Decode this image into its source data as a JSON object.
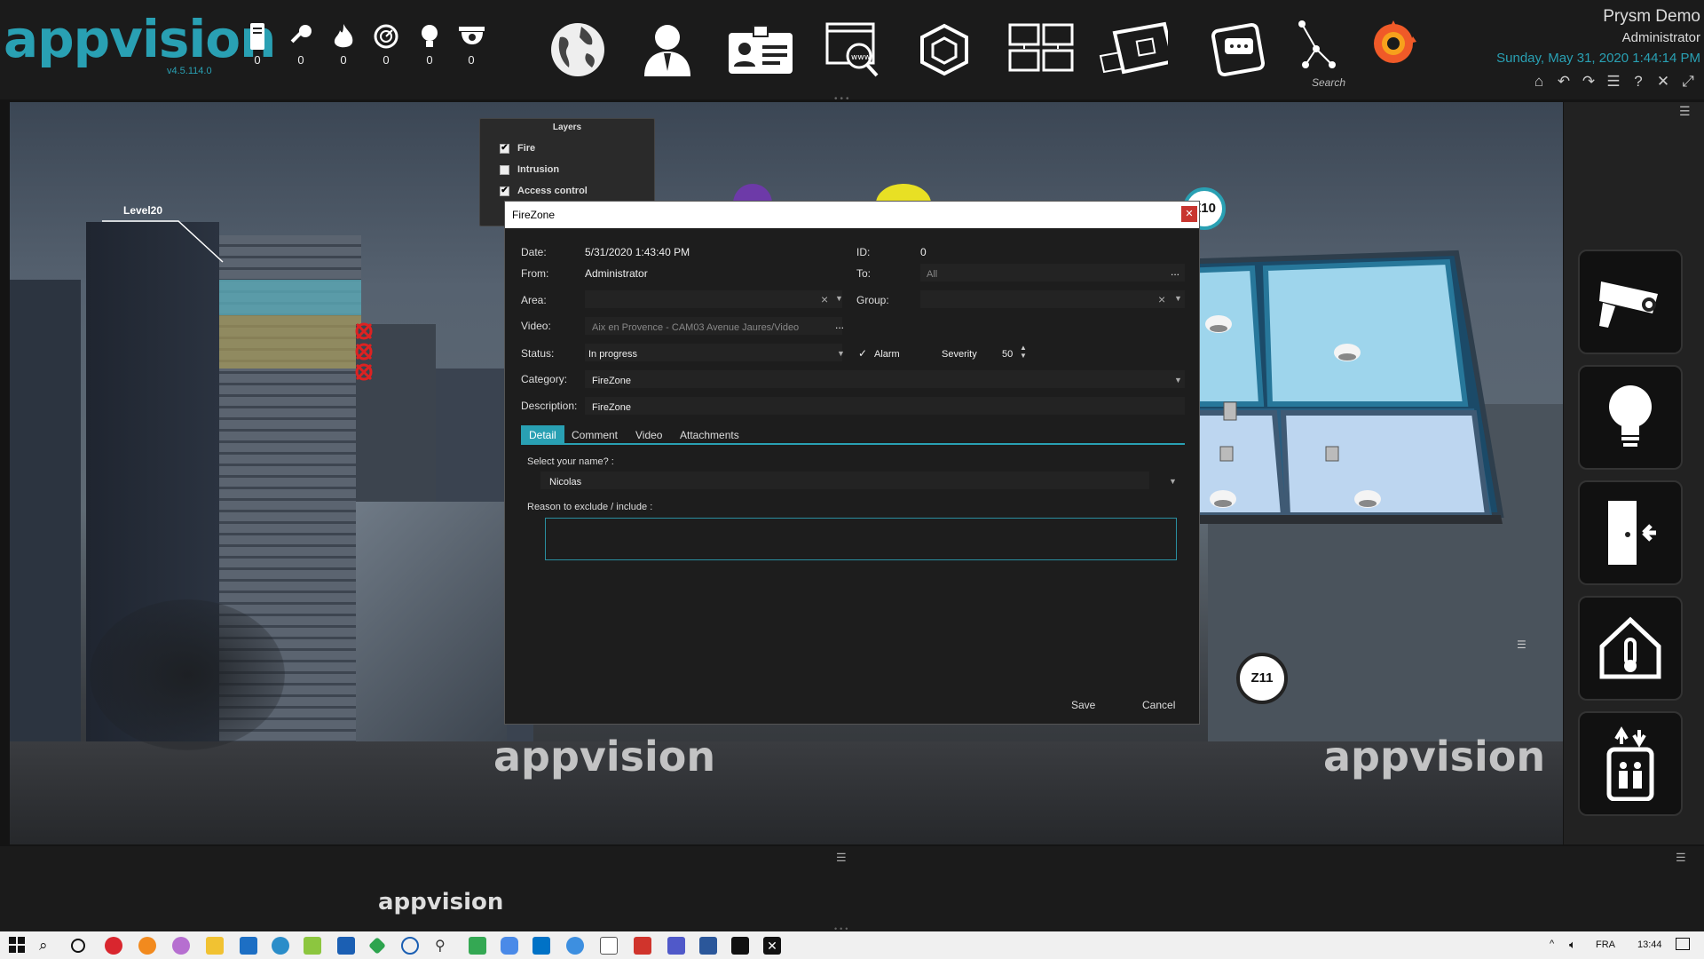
{
  "app": {
    "logo_text": "appvision",
    "version": "v4.5.114.0"
  },
  "counters": [
    {
      "icon": "server-icon",
      "value": "0"
    },
    {
      "icon": "key-icon",
      "value": "0"
    },
    {
      "icon": "fire-icon",
      "value": "0"
    },
    {
      "icon": "gauge-icon",
      "value": "0"
    },
    {
      "icon": "lightbulb-icon",
      "value": "0"
    },
    {
      "icon": "dome-camera-icon",
      "value": "0"
    }
  ],
  "nav_icons": [
    "globe-icon",
    "user-icon",
    "badge-card-icon",
    "web-search-icon",
    "cube-icon",
    "monitors-grid-icon",
    "3d-plan-icon",
    "chat-window-icon",
    "graph-search-icon",
    "grafana-icon"
  ],
  "search_label": "Search",
  "user": {
    "name": "Prysm Demo",
    "role": "Administrator",
    "datetime": "Sunday, May 31, 2020 1:44:14 PM"
  },
  "quick_icons": [
    "home-icon",
    "back-icon",
    "forward-icon",
    "alarm-list-icon",
    "help-icon",
    "tools-icon",
    "fullscreen-icon"
  ],
  "scene": {
    "level_label": "Level20",
    "zone_z10": "Z10",
    "zone_z11": "Z11",
    "watermark": "appvision"
  },
  "layers": {
    "title": "Layers",
    "items": [
      {
        "label": "Fire",
        "checked": true
      },
      {
        "label": "Intrusion",
        "checked": false
      },
      {
        "label": "Access control",
        "checked": true
      }
    ]
  },
  "dialog": {
    "title": "FireZone",
    "date_label": "Date:",
    "date_value": "5/31/2020 1:43:40 PM",
    "id_label": "ID:",
    "id_value": "0",
    "from_label": "From:",
    "from_value": "Administrator",
    "to_label": "To:",
    "to_value": "All",
    "area_label": "Area:",
    "group_label": "Group:",
    "video_label": "Video:",
    "video_value": "Aix en Provence - CAM03 Avenue Jaures/Video",
    "status_label": "Status:",
    "status_value": "In progress",
    "alarm_label": "Alarm",
    "severity_label": "Severity",
    "severity_value": "50",
    "category_label": "Category:",
    "category_value": "FireZone",
    "description_label": "Description:",
    "description_value": "FireZone",
    "tabs": [
      "Detail",
      "Comment",
      "Video",
      "Attachments"
    ],
    "name_prompt": "Select your name? :",
    "name_value": "Nicolas",
    "reason_label": "Reason to exclude / include :",
    "reason_value": "",
    "save_label": "Save",
    "cancel_label": "Cancel",
    "ellipsis": "..."
  },
  "taskbar": {
    "lang": "FRA",
    "time": "13:44"
  },
  "colors": {
    "accent": "#29a0b3",
    "close": "#c8352f"
  }
}
